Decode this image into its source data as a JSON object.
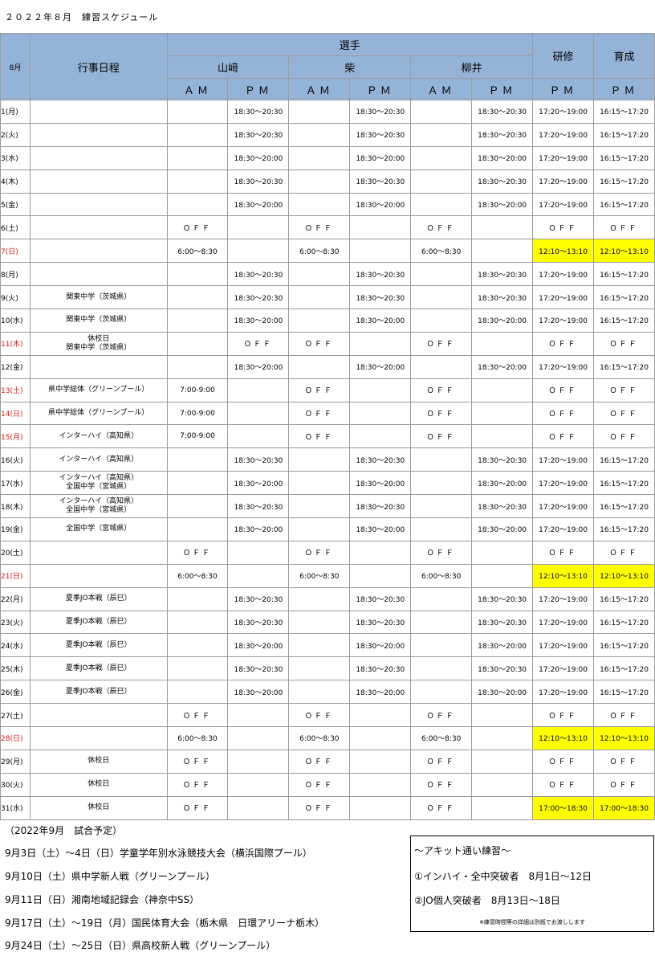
{
  "title": {
    "left": "２０２２年８月",
    "right": "練習スケジュール"
  },
  "header": {
    "month": "8月",
    "events": "行事日程",
    "players_group": "選手",
    "kenshu": "研修",
    "ikusei": "育成",
    "players": [
      "山﨑",
      "柴",
      "柳井"
    ],
    "am": "ＡＭ",
    "pm": "ＰＭ"
  },
  "rows": [
    {
      "day": "1(月)",
      "red": false,
      "ev": "",
      "cells": [
        "",
        "18:30～20:30",
        "",
        "18:30～20:30",
        "",
        "18:30～20:30",
        "17:20～19:00",
        "16:15～17:20"
      ],
      "hl": false
    },
    {
      "day": "2(火)",
      "red": false,
      "ev": "",
      "cells": [
        "",
        "18:30～20:30",
        "",
        "18:30～20:30",
        "",
        "18:30～20:30",
        "17:20～19:00",
        "16:15～17:20"
      ],
      "hl": false
    },
    {
      "day": "3(水)",
      "red": false,
      "ev": "",
      "cells": [
        "",
        "18:30～20:00",
        "",
        "18:30～20:00",
        "",
        "18:30～20:00",
        "17:20～19:00",
        "16:15～17:20"
      ],
      "hl": false
    },
    {
      "day": "4(木)",
      "red": false,
      "ev": "",
      "cells": [
        "",
        "18:30～20:30",
        "",
        "18:30～20:30",
        "",
        "18:30～20:30",
        "17:20～19:00",
        "16:15～17:20"
      ],
      "hl": false
    },
    {
      "day": "5(金)",
      "red": false,
      "ev": "",
      "cells": [
        "",
        "18:30～20:00",
        "",
        "18:30～20:00",
        "",
        "18:30～20:00",
        "17:20～19:00",
        "16:15～17:20"
      ],
      "hl": false
    },
    {
      "day": "6(土)",
      "red": false,
      "ev": "",
      "cells": [
        "ＯＦＦ",
        "",
        "ＯＦＦ",
        "",
        "ＯＦＦ",
        "",
        "ＯＦＦ",
        "ＯＦＦ"
      ],
      "hl": false
    },
    {
      "day": "7(日)",
      "red": true,
      "ev": "",
      "cells": [
        "6:00～8:30",
        "",
        "6:00～8:30",
        "",
        "6:00～8:30",
        "",
        "12:10～13:10",
        "12:10～13:10"
      ],
      "hl": true
    },
    {
      "day": "8(月)",
      "red": false,
      "ev": "",
      "cells": [
        "",
        "18:30～20:30",
        "",
        "18:30～20:30",
        "",
        "18:30～20:30",
        "17:20～19:00",
        "16:15～17:20"
      ],
      "hl": false
    },
    {
      "day": "9(火)",
      "red": false,
      "ev": "関東中学（茨城県）",
      "cells": [
        "",
        "18:30～20:30",
        "",
        "18:30～20:30",
        "",
        "18:30～20:30",
        "17:20～19:00",
        "16:15～17:20"
      ],
      "hl": false
    },
    {
      "day": "10(水)",
      "red": false,
      "ev": "関東中学（茨城県）",
      "cells": [
        "",
        "18:30～20:00",
        "",
        "18:30～20:00",
        "",
        "18:30～20:00",
        "17:20～19:00",
        "16:15～17:20"
      ],
      "hl": false
    },
    {
      "day": "11(木)",
      "red": true,
      "ev": "休校日\n関東中学（茨城県）",
      "cells": [
        "",
        "ＯＦＦ",
        "ＯＦＦ",
        "",
        "ＯＦＦ",
        "",
        "ＯＦＦ",
        "ＯＦＦ"
      ],
      "hl": false
    },
    {
      "day": "12(金)",
      "red": false,
      "ev": "",
      "cells": [
        "",
        "18:30～20:00",
        "",
        "18:30～20:00",
        "",
        "18:30～20:00",
        "17:20～19:00",
        "16:15～17:20"
      ],
      "hl": false
    },
    {
      "day": "13(土)",
      "red": true,
      "ev": "県中学総体（グリーンプール）",
      "cells": [
        "7:00-9:00",
        "",
        "ＯＦＦ",
        "",
        "ＯＦＦ",
        "",
        "ＯＦＦ",
        "ＯＦＦ"
      ],
      "hl": false
    },
    {
      "day": "14(日)",
      "red": true,
      "ev": "県中学総体（グリーンプール）",
      "cells": [
        "7:00-9:00",
        "",
        "ＯＦＦ",
        "",
        "ＯＦＦ",
        "",
        "ＯＦＦ",
        "ＯＦＦ"
      ],
      "hl": false
    },
    {
      "day": "15(月)",
      "red": true,
      "ev": "インターハイ（高知県）",
      "cells": [
        "7:00-9:00",
        "",
        "ＯＦＦ",
        "",
        "ＯＦＦ",
        "",
        "ＯＦＦ",
        "ＯＦＦ"
      ],
      "hl": false
    },
    {
      "day": "16(火)",
      "red": false,
      "ev": "インターハイ（高知県）",
      "cells": [
        "",
        "18:30～20:30",
        "",
        "18:30～20:30",
        "",
        "18:30～20:30",
        "17:20～19:00",
        "16:15～17:20"
      ],
      "hl": false
    },
    {
      "day": "17(水)",
      "red": false,
      "ev": "インターハイ（高知県）\n全国中学（宮城県）",
      "cells": [
        "",
        "18:30～20:00",
        "",
        "18:30～20:00",
        "",
        "18:30～20:00",
        "17:20～19:00",
        "16:15～17:20"
      ],
      "hl": false
    },
    {
      "day": "18(木)",
      "red": false,
      "ev": "インターハイ（高知県）\n全国中学（宮城県）",
      "cells": [
        "",
        "18:30～20:30",
        "",
        "18:30～20:30",
        "",
        "18:30～20:30",
        "17:20～19:00",
        "16:15～17:20"
      ],
      "hl": false
    },
    {
      "day": "19(金)",
      "red": false,
      "ev": "全国中学（宮城県）",
      "cells": [
        "",
        "18:30～20:00",
        "",
        "18:30～20:00",
        "",
        "18:30～20:00",
        "17:20～19:00",
        "16:15～17:20"
      ],
      "hl": false
    },
    {
      "day": "20(土)",
      "red": false,
      "ev": "",
      "cells": [
        "ＯＦＦ",
        "",
        "ＯＦＦ",
        "",
        "ＯＦＦ",
        "",
        "ＯＦＦ",
        "ＯＦＦ"
      ],
      "hl": false
    },
    {
      "day": "21(日)",
      "red": true,
      "ev": "",
      "cells": [
        "6:00～8:30",
        "",
        "6:00～8:30",
        "",
        "6:00～8:30",
        "",
        "12:10～13:10",
        "12:10～13:10"
      ],
      "hl": true
    },
    {
      "day": "22(月)",
      "red": false,
      "ev": "夏季JO本戦（辰巳）",
      "cells": [
        "",
        "18:30～20:30",
        "",
        "18:30～20:30",
        "",
        "18:30～20:30",
        "17:20～19:00",
        "16:15～17:20"
      ],
      "hl": false
    },
    {
      "day": "23(火)",
      "red": false,
      "ev": "夏季JO本戦（辰巳）",
      "cells": [
        "",
        "18:30～20:30",
        "",
        "18:30～20:30",
        "",
        "18:30～20:30",
        "17:20～19:00",
        "16:15～17:20"
      ],
      "hl": false
    },
    {
      "day": "24(水)",
      "red": false,
      "ev": "夏季JO本戦（辰巳）",
      "cells": [
        "",
        "18:30～20:00",
        "",
        "18:30～20:00",
        "",
        "18:30～20:00",
        "17:20～19:00",
        "16:15～17:20"
      ],
      "hl": false
    },
    {
      "day": "25(木)",
      "red": false,
      "ev": "夏季JO本戦（辰巳）",
      "cells": [
        "",
        "18:30～20:30",
        "",
        "18:30～20:30",
        "",
        "18:30～20:30",
        "17:20～19:00",
        "16:15～17:20"
      ],
      "hl": false
    },
    {
      "day": "26(金)",
      "red": false,
      "ev": "夏季JO本戦（辰巳）",
      "cells": [
        "",
        "18:30～20:00",
        "",
        "18:30～20:00",
        "",
        "18:30～20:00",
        "17:20～19:00",
        "16:15～17:20"
      ],
      "hl": false
    },
    {
      "day": "27(土)",
      "red": false,
      "ev": "",
      "cells": [
        "ＯＦＦ",
        "",
        "ＯＦＦ",
        "",
        "ＯＦＦ",
        "",
        "ＯＦＦ",
        "ＯＦＦ"
      ],
      "hl": false
    },
    {
      "day": "28(日)",
      "red": true,
      "ev": "",
      "cells": [
        "6:00～8:30",
        "",
        "6:00～8:30",
        "",
        "6:00～8:30",
        "",
        "12:10～13:10",
        "12:10～13:10"
      ],
      "hl": true
    },
    {
      "day": "29(月)",
      "red": false,
      "ev": "休校日",
      "cells": [
        "ＯＦＦ",
        "",
        "ＯＦＦ",
        "",
        "ＯＦＦ",
        "",
        "ＯＦＦ",
        "ＯＦＦ"
      ],
      "hl": false
    },
    {
      "day": "30(火)",
      "red": false,
      "ev": "休校日",
      "cells": [
        "ＯＦＦ",
        "",
        "ＯＦＦ",
        "",
        "ＯＦＦ",
        "",
        "ＯＦＦ",
        "ＯＦＦ"
      ],
      "hl": false
    },
    {
      "day": "31(水)",
      "red": false,
      "ev": "休校日",
      "cells": [
        "ＯＦＦ",
        "",
        "ＯＦＦ",
        "",
        "ＯＦＦ",
        "",
        "17:00～18:30",
        "17:00～18:30"
      ],
      "hl": true
    }
  ],
  "september": {
    "heading": "（2022年9月　試合予定）",
    "items": [
      "9月3日（土）～4日（日）学童学年別水泳競技大会（横浜国際プール）",
      "9月10日（土）県中学新人戦（グリーンプール）",
      "9月11日（日）湘南地域記録会（神奈中SS）",
      "9月17日（土）～19日（月）国民体育大会（栃木県　日環アリーナ栃木）",
      "9月24日（土）～25日（日）県高校新人戦（グリーンプール）"
    ]
  },
  "akit": {
    "title": "～アキット通い練習～",
    "line1": "①インハイ・全中突破者　8月1日～12日",
    "line2": "②JO個人突破者　8月13日～18日",
    "note": "※練習時間等の詳細は別紙でお渡しします"
  },
  "colors": {
    "header": "#95b3d7",
    "highlight": "#ffff00",
    "weekend_red": "#d91515"
  }
}
